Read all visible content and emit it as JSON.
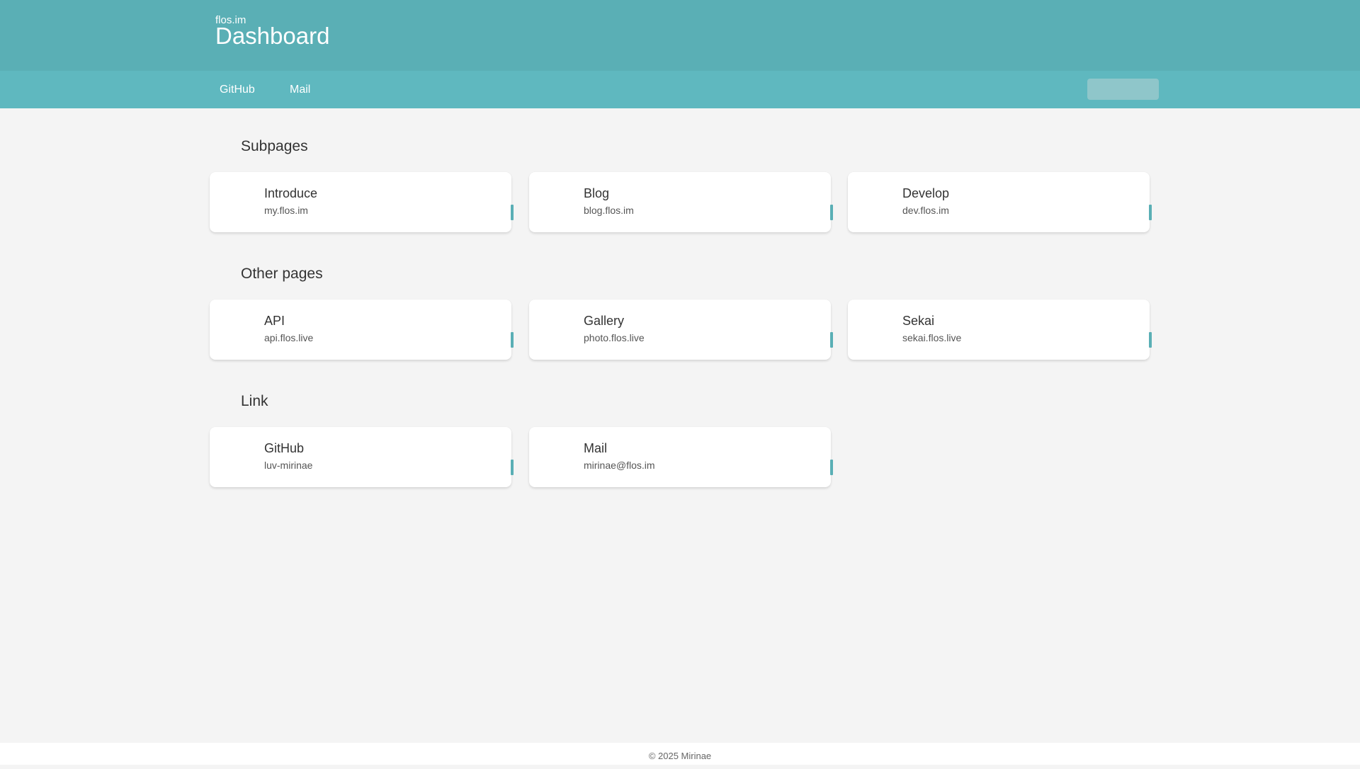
{
  "header": {
    "site": "flos.im",
    "title": "Dashboard"
  },
  "nav": {
    "links": [
      {
        "label": "GitHub"
      },
      {
        "label": "Mail"
      }
    ],
    "search_placeholder": ""
  },
  "sections": [
    {
      "title": "Subpages",
      "cards": [
        {
          "name": "Introduce",
          "url": "my.flos.im"
        },
        {
          "name": "Blog",
          "url": "blog.flos.im"
        },
        {
          "name": "Develop",
          "url": "dev.flos.im"
        }
      ]
    },
    {
      "title": "Other pages",
      "cards": [
        {
          "name": "API",
          "url": "api.flos.live"
        },
        {
          "name": "Gallery",
          "url": "photo.flos.live"
        },
        {
          "name": "Sekai",
          "url": "sekai.flos.live"
        }
      ]
    },
    {
      "title": "Link",
      "cards": [
        {
          "name": "GitHub",
          "url": "luv-mirinae"
        },
        {
          "name": "Mail",
          "url": "mirinae@flos.im"
        }
      ]
    }
  ],
  "footer": {
    "text": "© 2025 Mirinae"
  },
  "colors": {
    "header": "#5aafb5",
    "navbar": "#5fb8bf",
    "accent": "#5aafb5",
    "background": "#f4f4f4"
  }
}
